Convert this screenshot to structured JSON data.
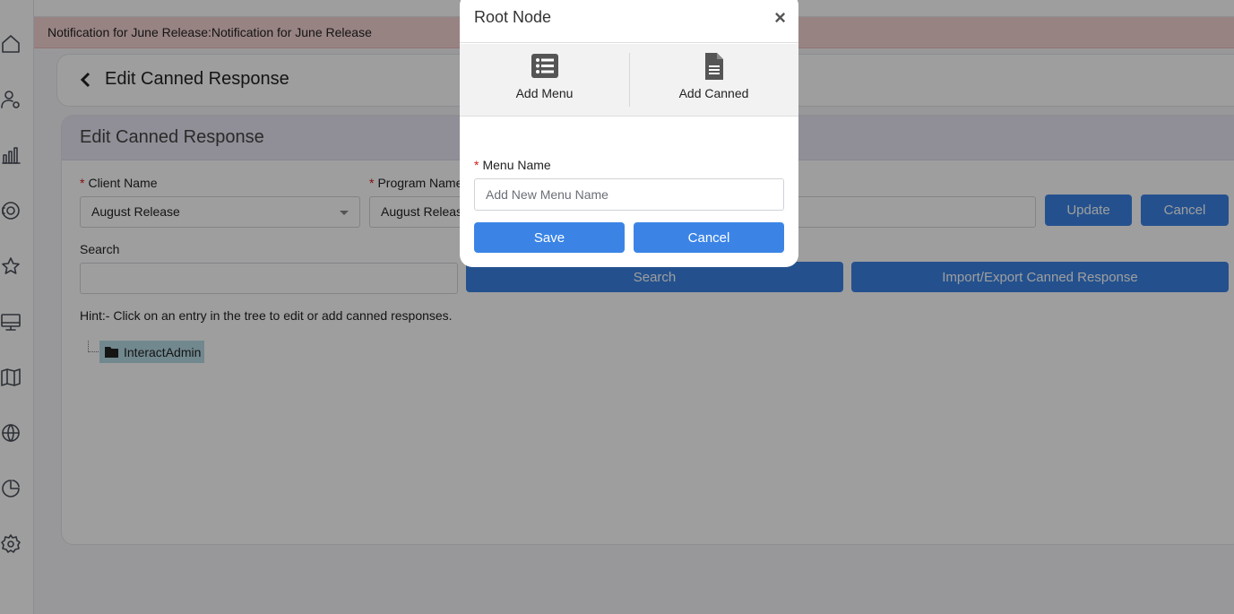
{
  "notification": "Notification for June Release:Notification for June Release",
  "header": {
    "title": "Edit Canned Response"
  },
  "form": {
    "title": "Edit Canned Response",
    "client_label": "Client Name",
    "client_value": "August Release",
    "program_label": "Program Name",
    "program_value": "August Release",
    "update_label": "Update",
    "cancel_label": "Cancel",
    "search_label": "Search",
    "search_button": "Search",
    "import_export_button": "Import/Export Canned Response",
    "hint": "Hint:- Click on an entry in the tree to edit or add canned responses."
  },
  "tree": {
    "root": "InteractAdmin"
  },
  "sidebar": {
    "icons": [
      "home-icon",
      "user-settings-icon",
      "bar-chart-icon",
      "support-icon",
      "star-icon",
      "monitor-icon",
      "book-icon",
      "globe-icon",
      "pie-chart-icon",
      "gear-icon"
    ]
  },
  "modal": {
    "title": "Root Node",
    "close": "×",
    "add_menu": "Add Menu",
    "add_canned": "Add Canned",
    "menu_name_label": "Menu Name",
    "menu_name_placeholder": "Add New Menu Name",
    "save": "Save",
    "cancel": "Cancel"
  },
  "colors": {
    "primary": "#3b84e6",
    "notification_bg": "#f6d3d3",
    "card_header_bg": "#e9e6f3",
    "tree_selected": "#b6dce6"
  }
}
